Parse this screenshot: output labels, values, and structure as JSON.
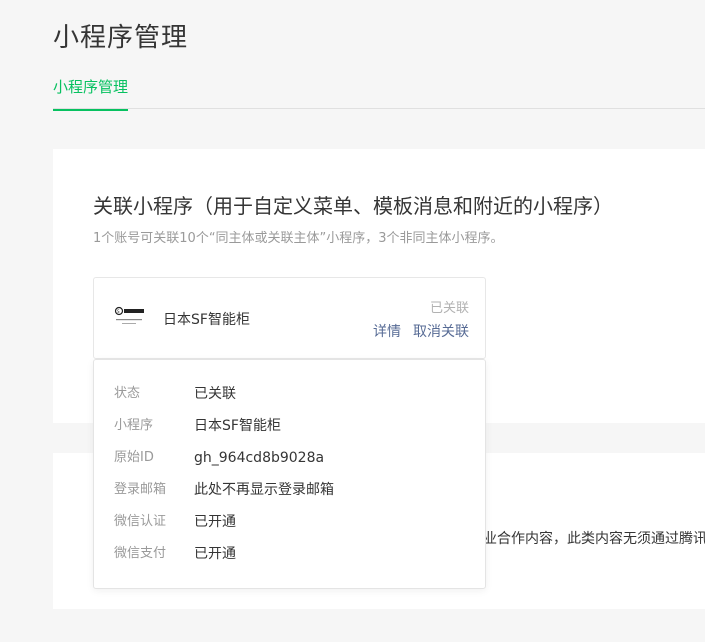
{
  "page": {
    "title": "小程序管理"
  },
  "tabs": [
    {
      "label": "小程序管理"
    }
  ],
  "linked_section": {
    "title": "关联小程序（用于自定义菜单、模板消息和附近的小程序）",
    "description": "1个账号可关联10个“同主体或关联主体”小程序，3个非同主体小程序。",
    "item": {
      "logo": "sf-express-logo",
      "logo_text": "SF EXPRESS",
      "name": "日本SF智能柜",
      "status": "已关联",
      "details_label": "详情",
      "unlink_label": "取消关联"
    }
  },
  "second_section": {
    "visible_text": "业合作内容，此类内容无须通过腾讯"
  },
  "popover": {
    "rows": [
      {
        "label": "状态",
        "value": "已关联"
      },
      {
        "label": "小程序",
        "value": "日本SF智能柜"
      },
      {
        "label": "原始ID",
        "value": "gh_964cd8b9028a"
      },
      {
        "label": "登录邮箱",
        "value": "此处不再显示登录邮箱"
      },
      {
        "label": "微信认证",
        "value": "已开通"
      },
      {
        "label": "微信支付",
        "value": "已开通"
      }
    ]
  },
  "colors": {
    "accent": "#07c160",
    "link": "#576b95",
    "muted": "#9a9a9a",
    "background": "#f6f6f6"
  }
}
